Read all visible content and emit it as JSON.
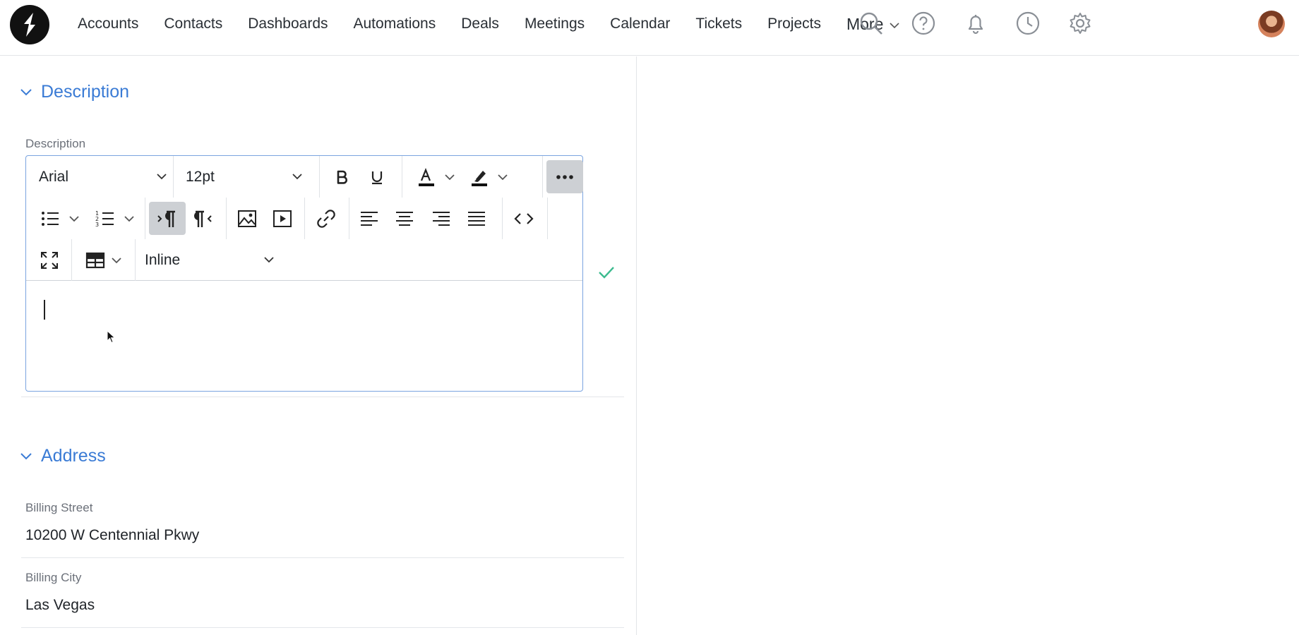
{
  "nav": {
    "items": [
      "Accounts",
      "Contacts",
      "Dashboards",
      "Automations",
      "Deals",
      "Meetings",
      "Calendar",
      "Tickets",
      "Projects"
    ],
    "more_label": "More"
  },
  "toolbar_icons": [
    "search-icon",
    "help-icon",
    "bell-icon",
    "clock-icon",
    "gear-icon"
  ],
  "description_section": {
    "title": "Description",
    "field_label": "Description",
    "editor": {
      "font_family": "Arial",
      "font_size": "12pt",
      "table_mode": "Inline",
      "content": ""
    }
  },
  "address_section": {
    "title": "Address",
    "fields": [
      {
        "label": "Billing Street",
        "value": "10200 W Centennial Pkwy"
      },
      {
        "label": "Billing City",
        "value": "Las Vegas"
      }
    ]
  },
  "colors": {
    "accent": "#3a7bd5",
    "save_check": "#3dbb8f"
  }
}
